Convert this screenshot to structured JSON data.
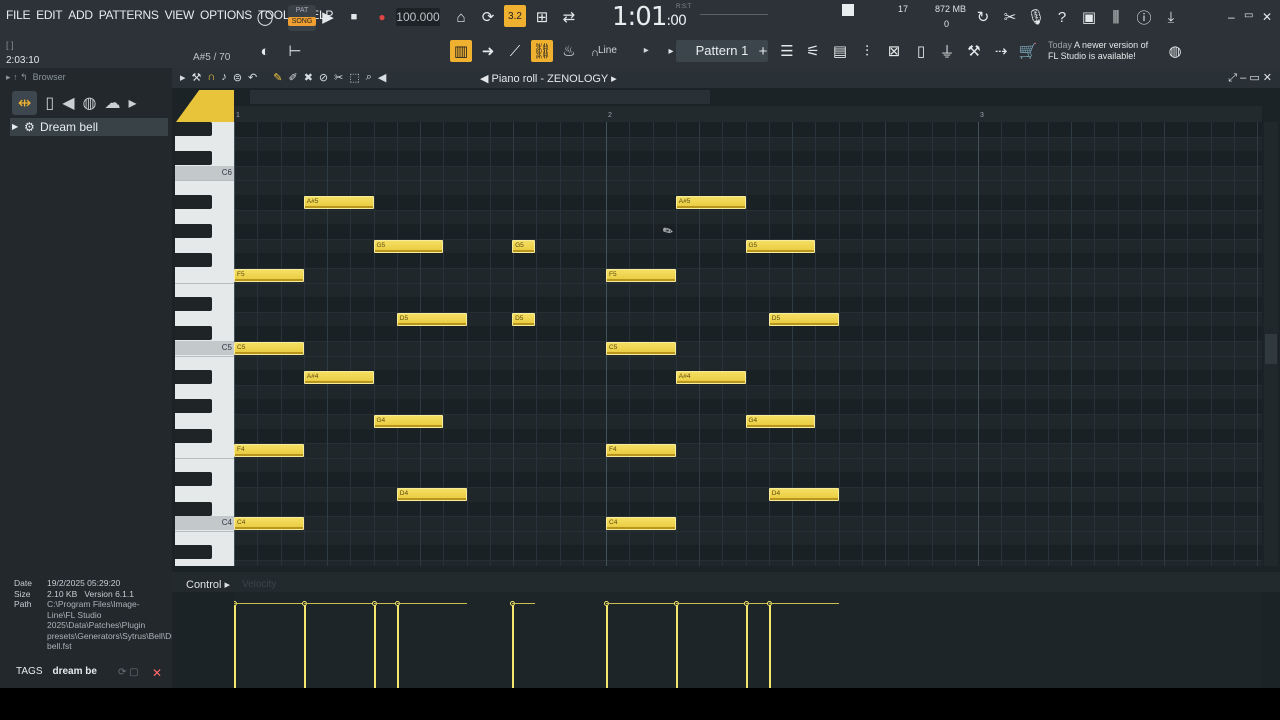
{
  "menu": [
    "FILE",
    "EDIT",
    "ADD",
    "PATTERNS",
    "VIEW",
    "OPTIONS",
    "TOOLS",
    "HELP"
  ],
  "transport": {
    "mode_top": "PAT",
    "mode": "SONG",
    "tempo": "100.000",
    "time": "1:01",
    "time_sub": ":00",
    "rst": "R:S:T"
  },
  "status": {
    "hint": "2:03:10",
    "hint_brackets": "[ ]",
    "note_info": "A#5 / 70",
    "cpu": "17",
    "memory": "872 MB",
    "mem_sub": "0"
  },
  "pattern": {
    "name": "Pattern 1",
    "plus": "+",
    "tool_mode": "Line"
  },
  "notice": {
    "when": "Today",
    "line1": "A newer version of",
    "line2": "FL Studio is available!"
  },
  "browser": {
    "title": "Browser",
    "preset": "Dream bell",
    "info": {
      "date_label": "Date",
      "date": "19/2/2025 05:29:20",
      "size_label": "Size",
      "size": "2.10 KB",
      "version_label": "Version",
      "version": "6.1.1",
      "path_label": "Path",
      "path": "C:\\Program Files\\Image-Line\\FL Studio 2025\\Data\\Patches\\Plugin presets\\Generators\\Sytrus\\Bell\\Dream bell.fst"
    },
    "tags_label": "TAGS",
    "tags_value": "dream be"
  },
  "piano_roll": {
    "title": "Piano roll - ZENOLOGY",
    "bars": [
      "1",
      "2",
      "3"
    ],
    "key_labels": [
      "C6",
      "C5",
      "C4"
    ],
    "control_label": "Control",
    "control_target": "Velocity",
    "notes": [
      {
        "label": "A#5",
        "pitch": 82,
        "start": 0.75,
        "len": 0.75
      },
      {
        "label": "G5",
        "pitch": 79,
        "start": 1.5,
        "len": 0.75
      },
      {
        "label": "G5",
        "pitch": 79,
        "start": 2.99,
        "len": 0.25
      },
      {
        "label": "F5",
        "pitch": 77,
        "start": 0,
        "len": 0.75
      },
      {
        "label": "D5",
        "pitch": 74,
        "start": 1.75,
        "len": 0.75
      },
      {
        "label": "D5",
        "pitch": 74,
        "start": 2.99,
        "len": 0.25
      },
      {
        "label": "C5",
        "pitch": 72,
        "start": 0,
        "len": 0.75
      },
      {
        "label": "A#4",
        "pitch": 70,
        "start": 0.75,
        "len": 0.75
      },
      {
        "label": "G4",
        "pitch": 67,
        "start": 1.5,
        "len": 0.75
      },
      {
        "label": "F4",
        "pitch": 65,
        "start": 0,
        "len": 0.75
      },
      {
        "label": "D4",
        "pitch": 62,
        "start": 1.75,
        "len": 0.75
      },
      {
        "label": "C4",
        "pitch": 60,
        "start": 0,
        "len": 0.75
      },
      {
        "label": "A#5",
        "pitch": 82,
        "start": 4.75,
        "len": 0.75
      },
      {
        "label": "G5",
        "pitch": 79,
        "start": 5.5,
        "len": 0.75
      },
      {
        "label": "F5",
        "pitch": 77,
        "start": 4,
        "len": 0.75
      },
      {
        "label": "D5",
        "pitch": 74,
        "start": 5.75,
        "len": 0.75
      },
      {
        "label": "C5",
        "pitch": 72,
        "start": 4,
        "len": 0.75
      },
      {
        "label": "A#4",
        "pitch": 70,
        "start": 4.75,
        "len": 0.75
      },
      {
        "label": "G4",
        "pitch": 67,
        "start": 5.5,
        "len": 0.75
      },
      {
        "label": "F4",
        "pitch": 65,
        "start": 4,
        "len": 0.75
      },
      {
        "label": "D4",
        "pitch": 62,
        "start": 5.75,
        "len": 0.75
      },
      {
        "label": "C4",
        "pitch": 60,
        "start": 4,
        "len": 0.75
      }
    ]
  },
  "colors": {
    "accent": "#f0b030",
    "note": "#efd34d",
    "velocity": "#f3e66a"
  }
}
